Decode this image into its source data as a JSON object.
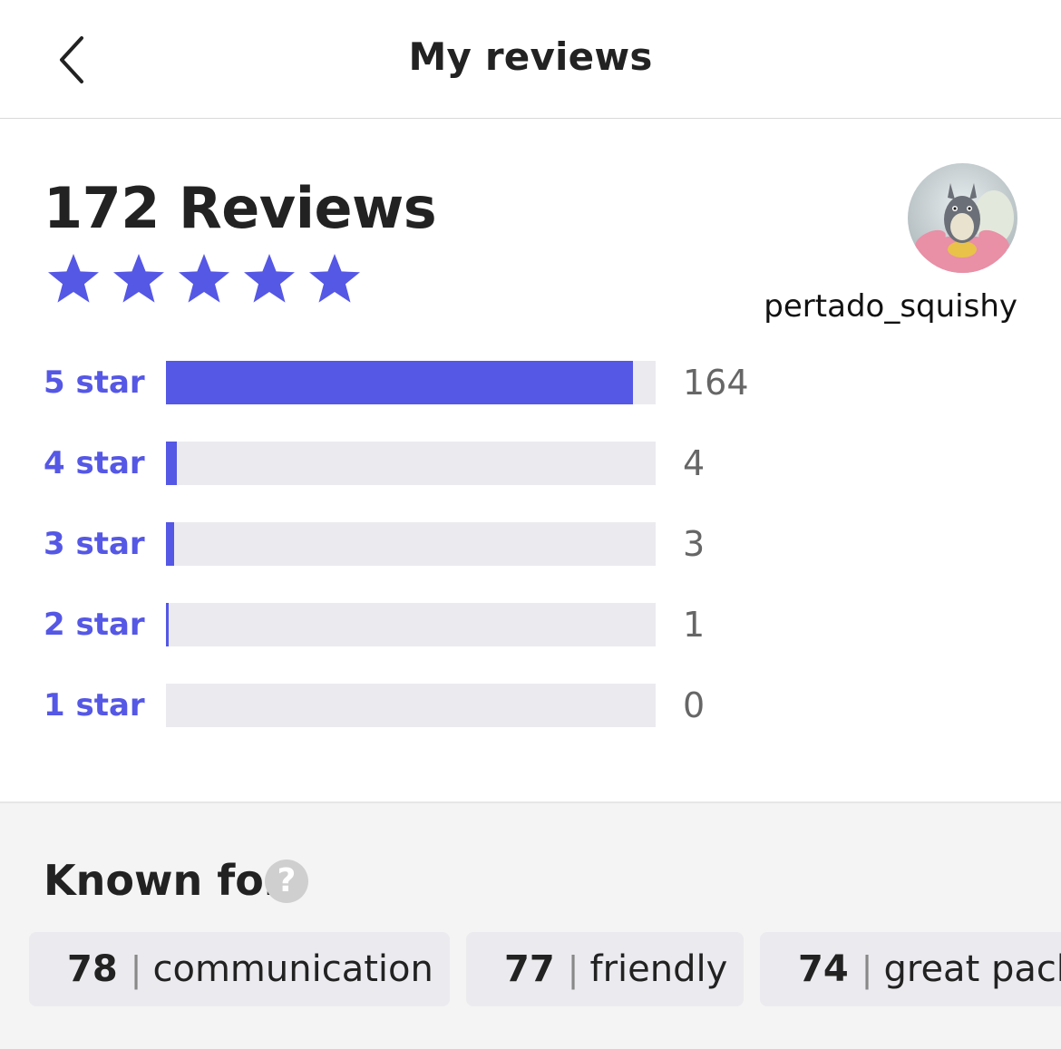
{
  "header": {
    "title": "My reviews"
  },
  "summary": {
    "reviews_label": "172 Reviews",
    "rating_stars": 5,
    "star_color": "#5557e5"
  },
  "profile": {
    "username": "pertado_squishy"
  },
  "ratings": [
    {
      "label": "5 star",
      "count": "164",
      "fraction": 0.953
    },
    {
      "label": "4 star",
      "count": "4",
      "fraction": 0.023
    },
    {
      "label": "3 star",
      "count": "3",
      "fraction": 0.017
    },
    {
      "label": "2 star",
      "count": "1",
      "fraction": 0.006
    },
    {
      "label": "1 star",
      "count": "0",
      "fraction": 0
    }
  ],
  "known_for": {
    "title": "Known for",
    "help_icon": "?",
    "tags": [
      {
        "count": "78",
        "label": "communication"
      },
      {
        "count": "77",
        "label": "friendly"
      },
      {
        "count": "74",
        "label": "great pack"
      }
    ]
  },
  "colors": {
    "accent": "#5557e5",
    "bar_track": "#ebebef",
    "section_bg": "#f4f4f4"
  },
  "icons": {
    "back": "chevron-left-icon",
    "star": "star-icon",
    "help": "question-circle-icon"
  }
}
